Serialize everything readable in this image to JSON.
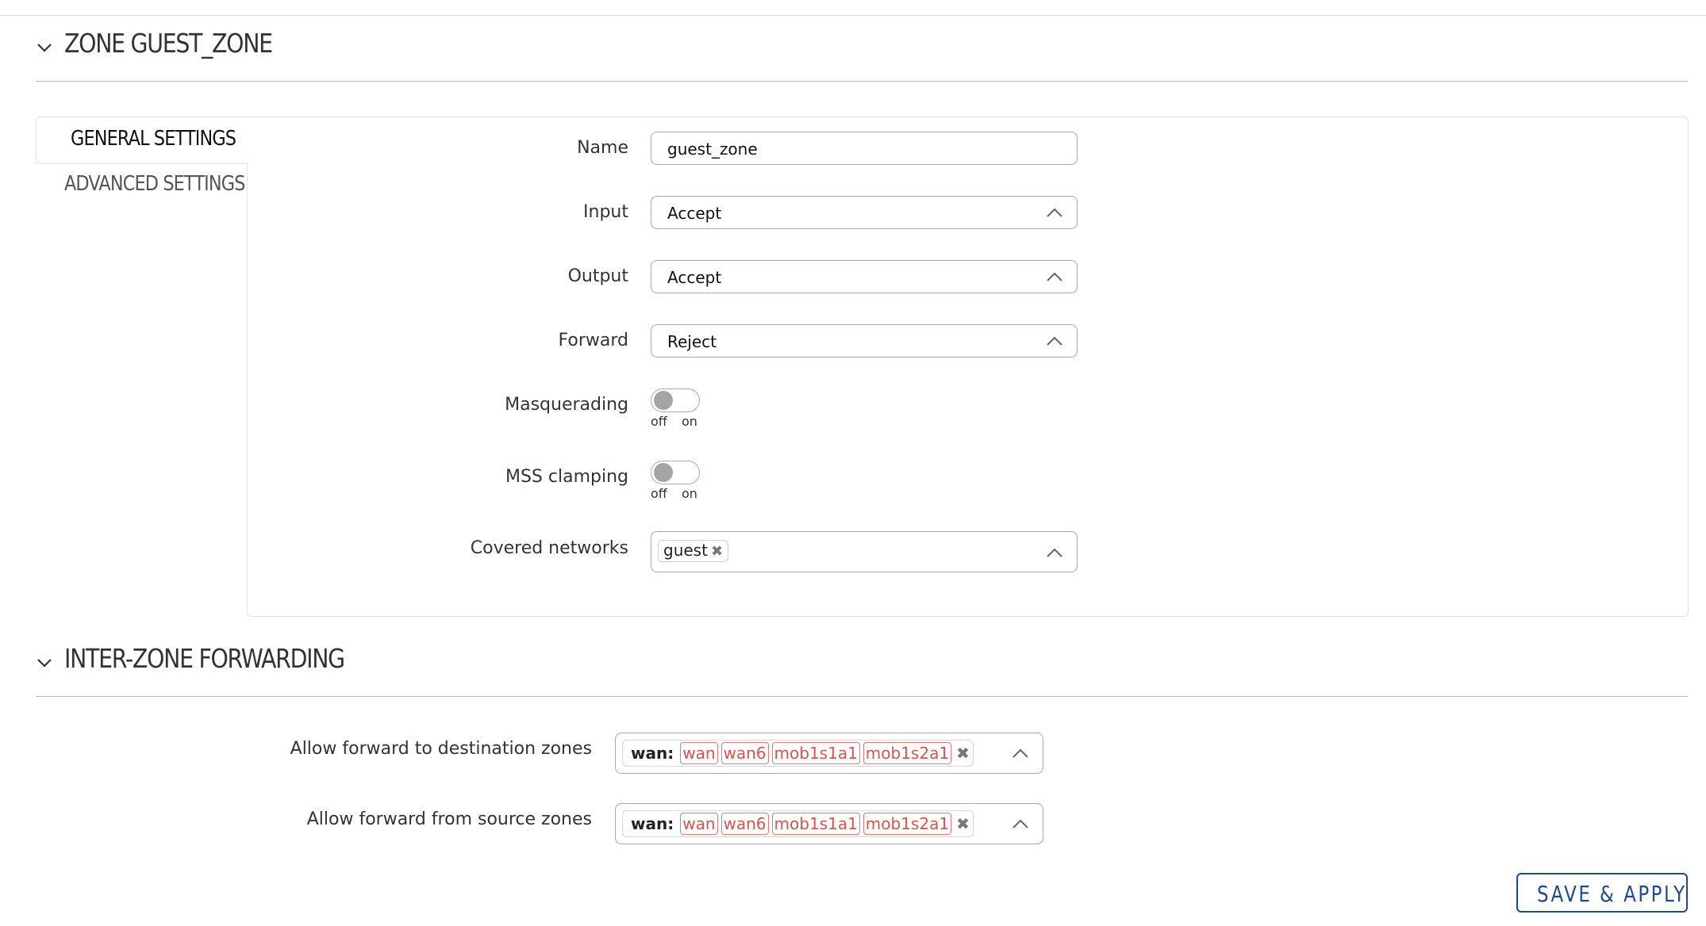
{
  "zone_section": {
    "title": "ZONE GUEST_ZONE"
  },
  "tabs": [
    {
      "label": "GENERAL SETTINGS",
      "active": true
    },
    {
      "label": "ADVANCED SETTINGS",
      "active": false
    }
  ],
  "general": {
    "name": {
      "label": "Name",
      "value": "guest_zone"
    },
    "input": {
      "label": "Input",
      "value": "Accept"
    },
    "output": {
      "label": "Output",
      "value": "Accept"
    },
    "forward": {
      "label": "Forward",
      "value": "Reject"
    },
    "masquerading": {
      "label": "Masquerading",
      "off": "off",
      "on": "on",
      "state": "off"
    },
    "mss_clamping": {
      "label": "MSS clamping",
      "off": "off",
      "on": "on",
      "state": "off"
    },
    "covered_networks": {
      "label": "Covered networks",
      "chips": [
        "guest"
      ]
    }
  },
  "izf_section": {
    "title": "INTER-ZONE FORWARDING"
  },
  "forwarding": {
    "to": {
      "label": "Allow forward to destination zones",
      "group": "wan:",
      "zones": [
        "wan",
        "wan6",
        "mob1s1a1",
        "mob1s2a1"
      ]
    },
    "from": {
      "label": "Allow forward from source zones",
      "group": "wan:",
      "zones": [
        "wan",
        "wan6",
        "mob1s1a1",
        "mob1s2a1"
      ]
    }
  },
  "actions": {
    "save_apply": "SAVE & APPLY"
  },
  "colors": {
    "accent": "#1e4b8f",
    "zone_tag": "#d9534f"
  }
}
